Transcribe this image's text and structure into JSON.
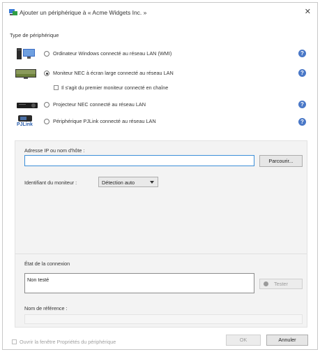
{
  "window": {
    "title": "Ajouter un périphérique à « Acme Widgets Inc. »",
    "close_glyph": "✕"
  },
  "device_type": {
    "group_label": "Type de périphérique",
    "options": [
      {
        "label": "Ordinateur Windows connecté au réseau LAN (WMI)",
        "selected": false,
        "icon": "windows-computer-icon"
      },
      {
        "label": "Moniteur NEC à écran large connecté au réseau LAN",
        "selected": true,
        "icon": "widescreen-monitor-icon"
      },
      {
        "label": "Projecteur NEC connecté au réseau LAN",
        "selected": false,
        "icon": "projector-icon"
      },
      {
        "label": "Périphérique PJLink connecté au réseau LAN",
        "selected": false,
        "icon": "pjlink-icon"
      }
    ],
    "daisy_chain_label": "Il s'agit du premier moniteur connecté en chaîne",
    "help_glyph": "?",
    "pjlink_logo_text": "PJLink"
  },
  "connection": {
    "ip_label": "Adresse IP ou nom d'hôte :",
    "ip_value": "",
    "browse_button": "Parcourir...",
    "monitor_id_label": "Identifiant du moniteur :",
    "monitor_id_value": "Détection auto",
    "status_label": "État de la connexion",
    "status_value": "Non testé",
    "test_button": "Tester",
    "reference_label": "Nom de référence :",
    "reference_value": ""
  },
  "footer": {
    "open_properties_label": "Ouvrir la fenêtre Propriétés du périphérique",
    "ok_button": "OK",
    "cancel_button": "Annuler"
  },
  "colors": {
    "accent": "#4a78c7",
    "focus_border": "#3c8fd8"
  }
}
